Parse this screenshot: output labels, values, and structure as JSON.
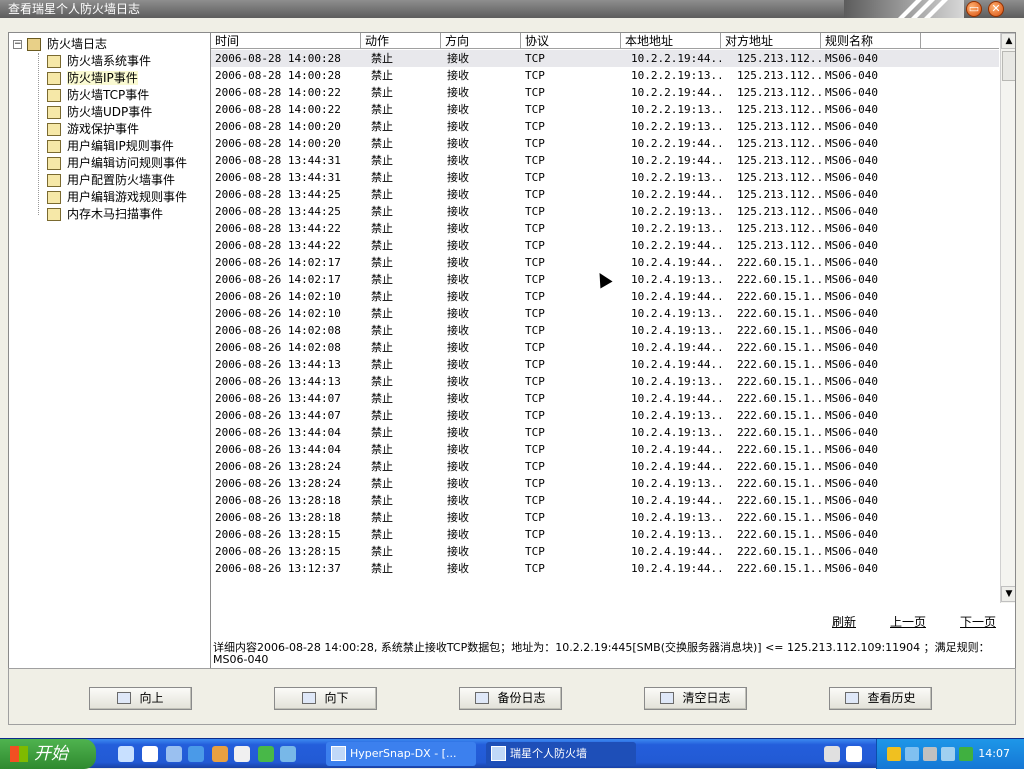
{
  "window": {
    "title": "查看瑞星个人防火墙日志"
  },
  "tree": {
    "root": "防火墙日志",
    "items": [
      {
        "label": "防火墙系统事件",
        "icon": "log-icon"
      },
      {
        "label": "防火墙IP事件",
        "icon": "ip-log-icon",
        "selected": true
      },
      {
        "label": "防火墙TCP事件",
        "icon": "computer-icon"
      },
      {
        "label": "防火墙UDP事件",
        "icon": "computer-icon"
      },
      {
        "label": "游戏保护事件",
        "icon": "exe-icon"
      },
      {
        "label": "用户编辑IP规则事件",
        "icon": "ip-rule-icon"
      },
      {
        "label": "用户编辑访问规则事件",
        "icon": "exe-rule-icon"
      },
      {
        "label": "用户配置防火墙事件",
        "icon": "config-icon"
      },
      {
        "label": "用户编辑游戏规则事件",
        "icon": "game-rule-icon"
      },
      {
        "label": "内存木马扫描事件",
        "icon": "scan-icon"
      }
    ]
  },
  "table": {
    "headers": [
      "时间",
      "动作",
      "方向",
      "协议",
      "本地地址",
      "对方地址",
      "规则名称"
    ],
    "rows": [
      [
        "2006-08-28 14:00:28",
        "禁止",
        "接收",
        "TCP",
        "10.2.2.19:44...",
        "125.213.112...",
        "MS06-040"
      ],
      [
        "2006-08-28 14:00:28",
        "禁止",
        "接收",
        "TCP",
        "10.2.2.19:13...",
        "125.213.112...",
        "MS06-040"
      ],
      [
        "2006-08-28 14:00:22",
        "禁止",
        "接收",
        "TCP",
        "10.2.2.19:44...",
        "125.213.112...",
        "MS06-040"
      ],
      [
        "2006-08-28 14:00:22",
        "禁止",
        "接收",
        "TCP",
        "10.2.2.19:13...",
        "125.213.112...",
        "MS06-040"
      ],
      [
        "2006-08-28 14:00:20",
        "禁止",
        "接收",
        "TCP",
        "10.2.2.19:13...",
        "125.213.112...",
        "MS06-040"
      ],
      [
        "2006-08-28 14:00:20",
        "禁止",
        "接收",
        "TCP",
        "10.2.2.19:44...",
        "125.213.112...",
        "MS06-040"
      ],
      [
        "2006-08-28 13:44:31",
        "禁止",
        "接收",
        "TCP",
        "10.2.2.19:44...",
        "125.213.112...",
        "MS06-040"
      ],
      [
        "2006-08-28 13:44:31",
        "禁止",
        "接收",
        "TCP",
        "10.2.2.19:13...",
        "125.213.112...",
        "MS06-040"
      ],
      [
        "2006-08-28 13:44:25",
        "禁止",
        "接收",
        "TCP",
        "10.2.2.19:44...",
        "125.213.112...",
        "MS06-040"
      ],
      [
        "2006-08-28 13:44:25",
        "禁止",
        "接收",
        "TCP",
        "10.2.2.19:13...",
        "125.213.112...",
        "MS06-040"
      ],
      [
        "2006-08-28 13:44:22",
        "禁止",
        "接收",
        "TCP",
        "10.2.2.19:13...",
        "125.213.112...",
        "MS06-040"
      ],
      [
        "2006-08-28 13:44:22",
        "禁止",
        "接收",
        "TCP",
        "10.2.2.19:44...",
        "125.213.112...",
        "MS06-040"
      ],
      [
        "2006-08-26 14:02:17",
        "禁止",
        "接收",
        "TCP",
        "10.2.4.19:44...",
        "222.60.15.1...",
        "MS06-040"
      ],
      [
        "2006-08-26 14:02:17",
        "禁止",
        "接收",
        "TCP",
        "10.2.4.19:13...",
        "222.60.15.1...",
        "MS06-040"
      ],
      [
        "2006-08-26 14:02:10",
        "禁止",
        "接收",
        "TCP",
        "10.2.4.19:44...",
        "222.60.15.1...",
        "MS06-040"
      ],
      [
        "2006-08-26 14:02:10",
        "禁止",
        "接收",
        "TCP",
        "10.2.4.19:13...",
        "222.60.15.1...",
        "MS06-040"
      ],
      [
        "2006-08-26 14:02:08",
        "禁止",
        "接收",
        "TCP",
        "10.2.4.19:13...",
        "222.60.15.1...",
        "MS06-040"
      ],
      [
        "2006-08-26 14:02:08",
        "禁止",
        "接收",
        "TCP",
        "10.2.4.19:44...",
        "222.60.15.1...",
        "MS06-040"
      ],
      [
        "2006-08-26 13:44:13",
        "禁止",
        "接收",
        "TCP",
        "10.2.4.19:44...",
        "222.60.15.1...",
        "MS06-040"
      ],
      [
        "2006-08-26 13:44:13",
        "禁止",
        "接收",
        "TCP",
        "10.2.4.19:13...",
        "222.60.15.1...",
        "MS06-040"
      ],
      [
        "2006-08-26 13:44:07",
        "禁止",
        "接收",
        "TCP",
        "10.2.4.19:44...",
        "222.60.15.1...",
        "MS06-040"
      ],
      [
        "2006-08-26 13:44:07",
        "禁止",
        "接收",
        "TCP",
        "10.2.4.19:13...",
        "222.60.15.1...",
        "MS06-040"
      ],
      [
        "2006-08-26 13:44:04",
        "禁止",
        "接收",
        "TCP",
        "10.2.4.19:13...",
        "222.60.15.1...",
        "MS06-040"
      ],
      [
        "2006-08-26 13:44:04",
        "禁止",
        "接收",
        "TCP",
        "10.2.4.19:44...",
        "222.60.15.1...",
        "MS06-040"
      ],
      [
        "2006-08-26 13:28:24",
        "禁止",
        "接收",
        "TCP",
        "10.2.4.19:44...",
        "222.60.15.1...",
        "MS06-040"
      ],
      [
        "2006-08-26 13:28:24",
        "禁止",
        "接收",
        "TCP",
        "10.2.4.19:13...",
        "222.60.15.1...",
        "MS06-040"
      ],
      [
        "2006-08-26 13:28:18",
        "禁止",
        "接收",
        "TCP",
        "10.2.4.19:44...",
        "222.60.15.1...",
        "MS06-040"
      ],
      [
        "2006-08-26 13:28:18",
        "禁止",
        "接收",
        "TCP",
        "10.2.4.19:13...",
        "222.60.15.1...",
        "MS06-040"
      ],
      [
        "2006-08-26 13:28:15",
        "禁止",
        "接收",
        "TCP",
        "10.2.4.19:13...",
        "222.60.15.1...",
        "MS06-040"
      ],
      [
        "2006-08-26 13:28:15",
        "禁止",
        "接收",
        "TCP",
        "10.2.4.19:44...",
        "222.60.15.1...",
        "MS06-040"
      ],
      [
        "2006-08-26 13:12:37",
        "禁止",
        "接收",
        "TCP",
        "10.2.4.19:44...",
        "222.60.15.1...",
        "MS06-040"
      ]
    ]
  },
  "pager": {
    "refresh": "刷新",
    "prev": "上一页",
    "next": "下一页"
  },
  "detail": {
    "text": "详细内容2006-08-28 14:00:28, 系统禁止接收TCP数据包；地址为：10.2.2.19:445[SMB(交换服务器消息块)] <= 125.213.112.109:11904 ；满足规则：MS06-040"
  },
  "buttons": {
    "up": "向上",
    "down": "向下",
    "backup": "备份日志",
    "clear": "清空日志",
    "history": "查看历史"
  },
  "taskbar": {
    "start": "开始",
    "tasks": [
      "HyperSnap-DX - [...",
      "瑞星个人防火墙"
    ],
    "clock": "14:07"
  }
}
